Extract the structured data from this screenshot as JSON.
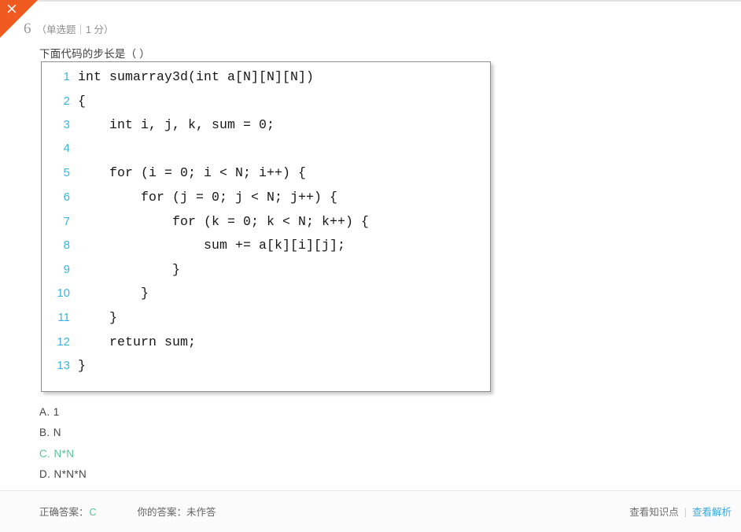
{
  "close_button": {
    "icon": "close-icon",
    "glyph": "×",
    "color": "#ef5a21"
  },
  "question": {
    "number": "6",
    "meta": "（单选题｜1 分）",
    "stem": "下面代码的步长是（ ）"
  },
  "code_block": {
    "language": "c",
    "lines": [
      {
        "no": "1",
        "text": "int sumarray3d(int a[N][N][N])"
      },
      {
        "no": "2",
        "text": "{"
      },
      {
        "no": "3",
        "text": "    int i, j, k, sum = 0;"
      },
      {
        "no": "4",
        "text": ""
      },
      {
        "no": "5",
        "text": "    for (i = 0; i < N; i++) {"
      },
      {
        "no": "6",
        "text": "        for (j = 0; j < N; j++) {"
      },
      {
        "no": "7",
        "text": "            for (k = 0; k < N; k++) {"
      },
      {
        "no": "8",
        "text": "                sum += a[k][i][j];"
      },
      {
        "no": "9",
        "text": "            }"
      },
      {
        "no": "10",
        "text": "        }"
      },
      {
        "no": "11",
        "text": "    }"
      },
      {
        "no": "12",
        "text": "    return sum;"
      },
      {
        "no": "13",
        "text": "}"
      }
    ]
  },
  "options": [
    {
      "label": "A. 1",
      "correct": false
    },
    {
      "label": "B. N",
      "correct": false
    },
    {
      "label": "C. N*N",
      "correct": true
    },
    {
      "label": "D. N*N*N",
      "correct": false
    }
  ],
  "footer": {
    "correct_answer_label": "正确答案：",
    "correct_answer_value": "C",
    "your_answer": "你的答案：未作答",
    "view_knowledge_point": "查看知识点",
    "separator": "|",
    "view_analysis": "查看解析"
  },
  "colors": {
    "accent_orange": "#ef5a21",
    "line_number_blue": "#3fb3dd",
    "correct_green": "#5cc39a",
    "link_blue": "#3fa9dd"
  }
}
